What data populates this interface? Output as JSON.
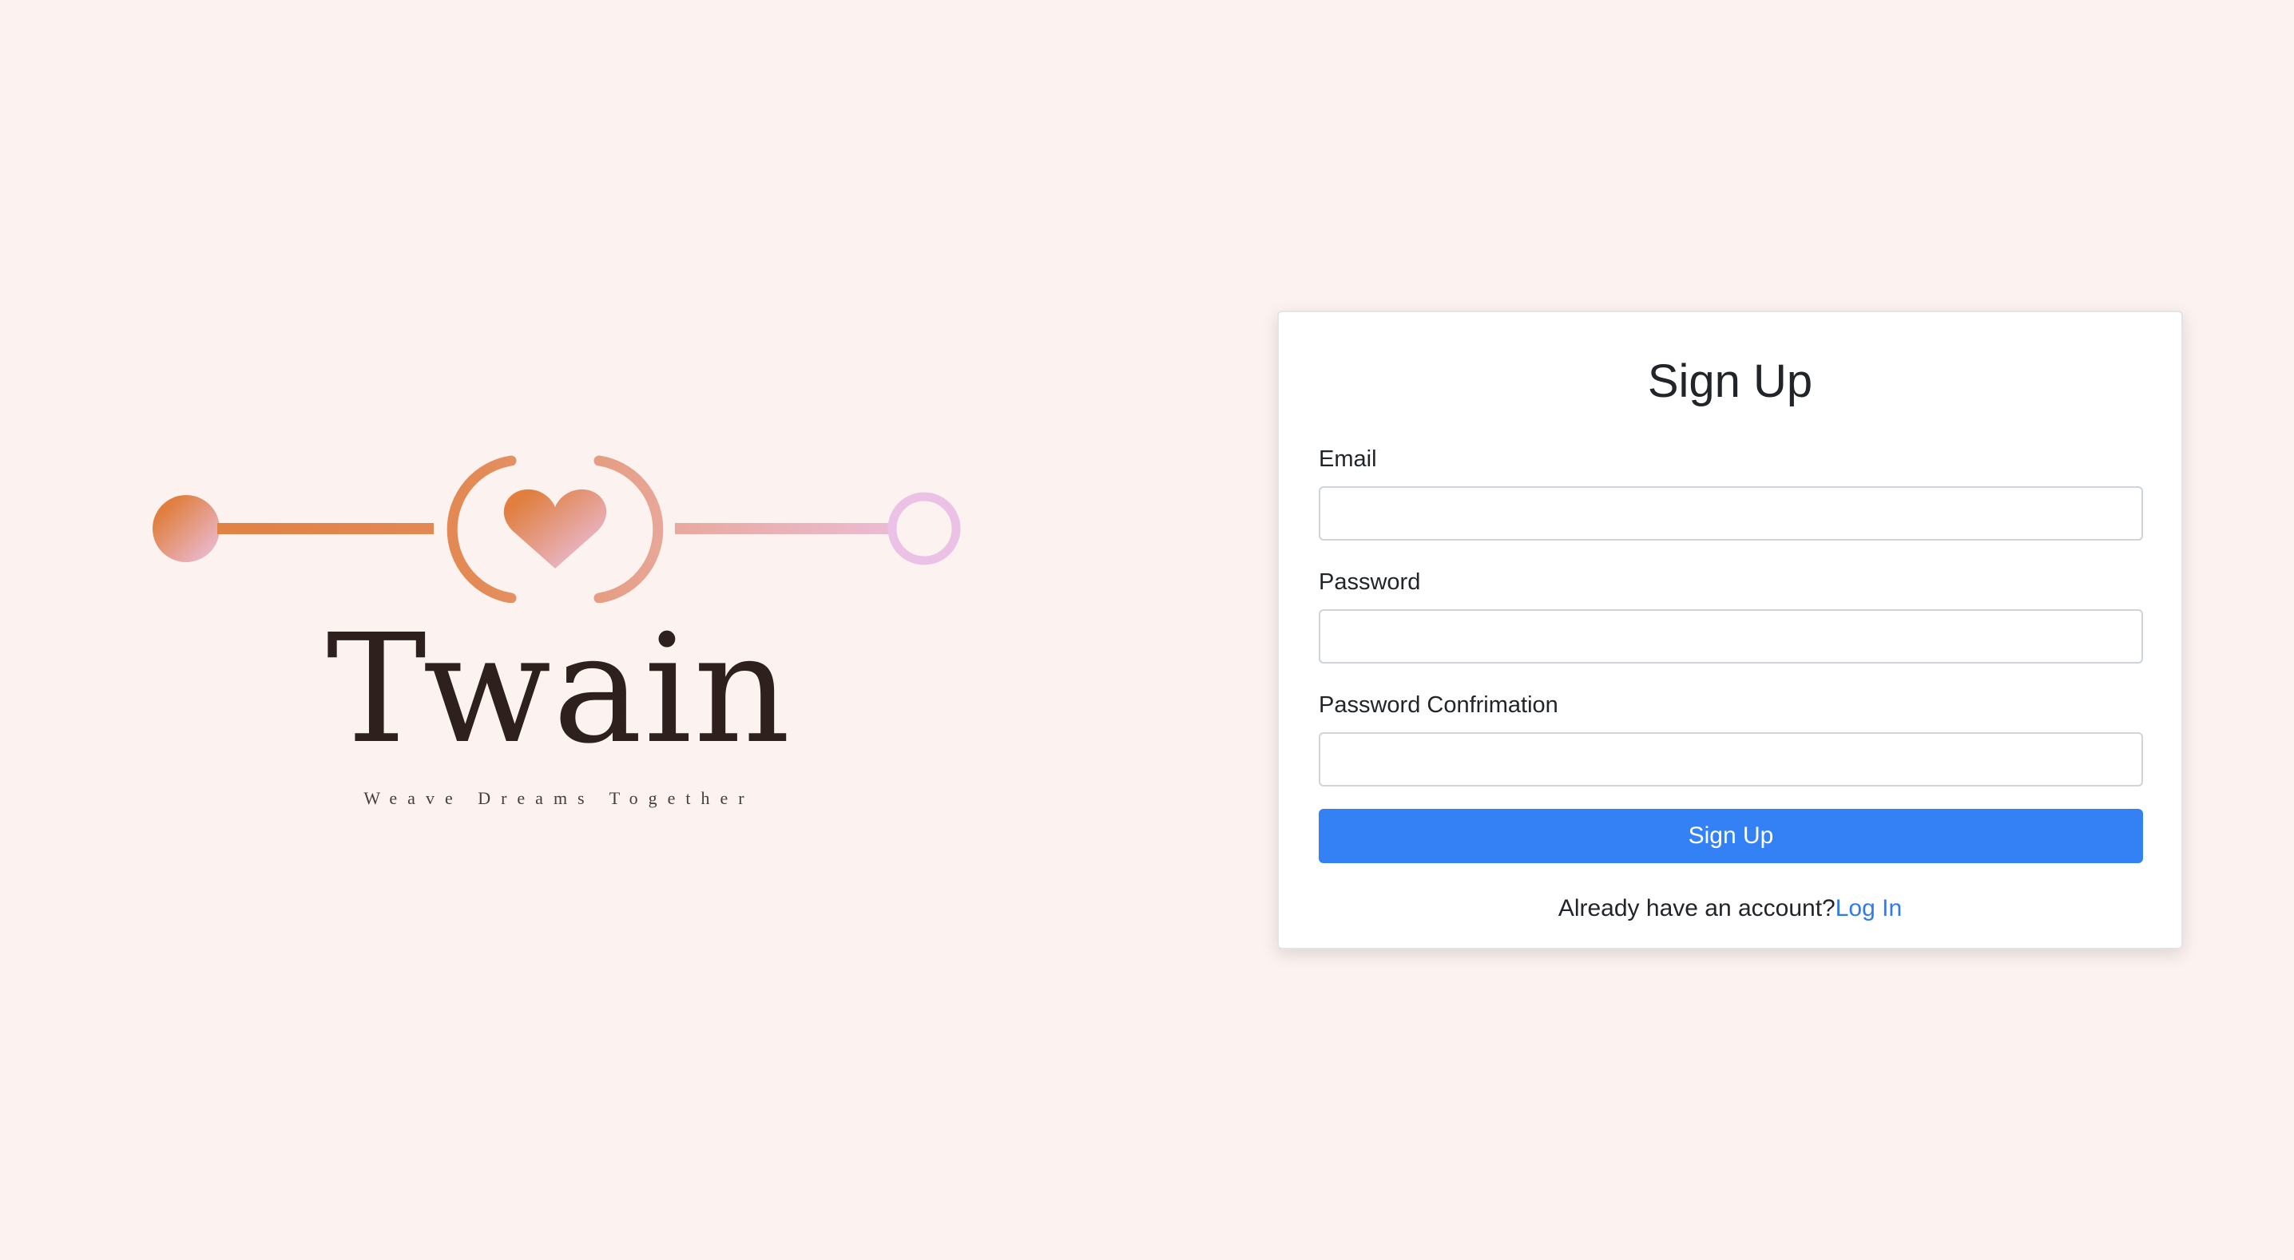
{
  "brand": {
    "name": "Twain",
    "tagline": "Weave Dreams Together",
    "colors": {
      "orange": "#e07f40",
      "pink": "#ebc2e6",
      "background": "#fcf3f0",
      "text": "#2e211d"
    }
  },
  "form": {
    "title": "Sign Up",
    "fields": [
      {
        "label": "Email",
        "value": "",
        "placeholder": ""
      },
      {
        "label": "Password",
        "value": "",
        "placeholder": ""
      },
      {
        "label": "Password Confrimation",
        "value": "",
        "placeholder": ""
      }
    ],
    "submit_label": "Sign Up",
    "login_prompt": "Already have an account?",
    "login_link": "Log In",
    "accent_color": "#3381f5"
  }
}
